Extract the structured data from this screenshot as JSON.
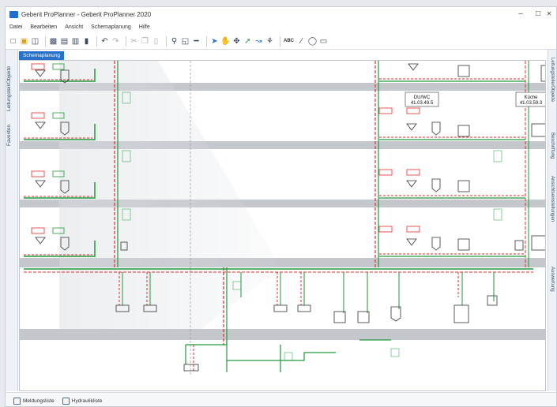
{
  "window": {
    "title": "Geberit ProPlanner - Geberit ProPlanner 2020",
    "minimize": "–",
    "maximize": "□",
    "close": "✕"
  },
  "menu": [
    "Datei",
    "Bearbeiten",
    "Ansicht",
    "Schemaplanung",
    "Hilfe"
  ],
  "toolbar": {
    "text_tool": "ABC"
  },
  "left_tabs": [
    "Leitungsteil/Objekte",
    "Favoriten"
  ],
  "document_tab": "Schemaplanung",
  "right_tabs": [
    "Leitungsteile/Objekte",
    "Beschriftung",
    "Ansichtseinstellungen",
    "Auswertung"
  ],
  "drawing": {
    "room_labels": [
      {
        "name": "DU/WC",
        "code": "41.03.49.5"
      },
      {
        "name": "Küche",
        "code": "41.03.59.3"
      }
    ]
  },
  "status": {
    "left": "Meldungsliste",
    "right": "Hydraulikliste"
  },
  "colors": {
    "accent": "#2a72c9",
    "pipe_green": "#1e9a3a",
    "pipe_red": "#e8292b",
    "floor_grey": "#c4c8cd"
  }
}
